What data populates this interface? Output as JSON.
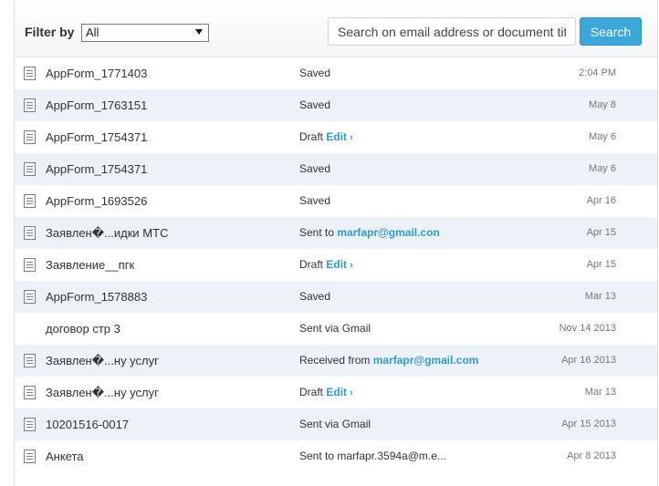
{
  "toolbar": {
    "filter_label": "Filter by",
    "filter_value": "All",
    "search_placeholder": "Search on email address or document title",
    "search_button": "Search"
  },
  "documents": [
    {
      "title": "AppForm_1771403",
      "status": "Saved",
      "link": "",
      "date": "2:04 PM",
      "icon": "document-icon"
    },
    {
      "title": "AppForm_1763151",
      "status": "Saved",
      "link": "",
      "date": "May 8",
      "icon": "document-icon"
    },
    {
      "title": "AppForm_1754371",
      "status": "Draft",
      "link": "Edit",
      "date": "May 6",
      "icon": "document-icon"
    },
    {
      "title": "AppForm_1754371",
      "status": "Saved",
      "link": "",
      "date": "May 6",
      "icon": "document-icon"
    },
    {
      "title": "AppForm_1693526",
      "status": "Saved",
      "link": "",
      "date": "Apr 16",
      "icon": "document-icon"
    },
    {
      "title": "Заявлен�...идки МТС",
      "status": "Sent to",
      "link": "marfapr@gmail.con",
      "date": "Apr 15",
      "icon": "document-icon"
    },
    {
      "title": "Заявление__пгк",
      "status": "Draft",
      "link": "Edit",
      "date": "Apr 15",
      "icon": "document-icon"
    },
    {
      "title": "AppForm_1578883",
      "status": "Saved",
      "link": "",
      "date": "Mar 13",
      "icon": "document-icon"
    },
    {
      "title": "договор стр 3",
      "status": "Sent via Gmail",
      "link": "",
      "date": "Nov 14 2013",
      "icon": ""
    },
    {
      "title": "Заявлен�...ну услуг",
      "status": "Received from",
      "link": "marfapr@gmail.com",
      "date": "Apr 16 2013",
      "icon": "document-icon"
    },
    {
      "title": "Заявлен�...ну услуг",
      "status": "Draft",
      "link": "Edit",
      "date": "Mar 13",
      "icon": "document-icon"
    },
    {
      "title": "10201516-0017",
      "status": "Sent via Gmail",
      "link": "",
      "date": "Apr 15 2013",
      "icon": "document-icon"
    },
    {
      "title": "Анкета",
      "status": "Sent to marfapr.3594a@m.e...",
      "link": "",
      "date": "Apr 8 2013",
      "icon": "document-icon"
    }
  ]
}
